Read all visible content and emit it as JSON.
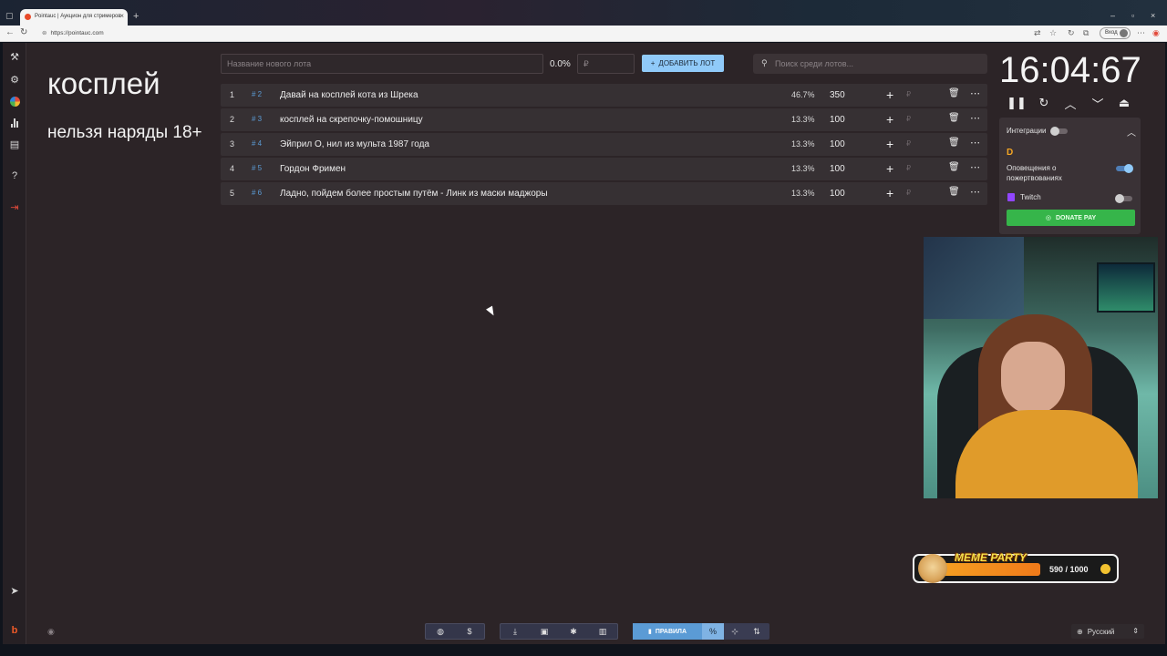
{
  "browser": {
    "tab_title": "Pointauc | Аукцион для стримеров",
    "url": "https://pointauc.com",
    "login_label": "Вход"
  },
  "lot": {
    "title": "косплей",
    "subtitle": "нельзя наряды 18+"
  },
  "controls": {
    "new_lot_placeholder": "Название нового лота",
    "percent": "0.0%",
    "amount_placeholder": "₽",
    "add_button": "ДОБАВИТЬ ЛОТ",
    "search_placeholder": "Поиск среди лотов..."
  },
  "lots": [
    {
      "num": "1",
      "id": "# 2",
      "name": "Давай на косплей кота из Шрека",
      "percent": "46.7%",
      "amount": "350"
    },
    {
      "num": "2",
      "id": "# 3",
      "name": "косплей на скрепочку-помошницу",
      "percent": "13.3%",
      "amount": "100"
    },
    {
      "num": "3",
      "id": "# 4",
      "name": "Эйприл О, нил из мульта 1987 года",
      "percent": "13.3%",
      "amount": "100"
    },
    {
      "num": "4",
      "id": "# 5",
      "name": "Гордон Фримен",
      "percent": "13.3%",
      "amount": "100"
    },
    {
      "num": "5",
      "id": "# 6",
      "name": "Ладно, пойдем более простым путём - Линк из маски маджоры",
      "percent": "13.3%",
      "amount": "100"
    }
  ],
  "lot_currency": "₽",
  "timer": "16:04:67",
  "integrations": {
    "title": "Интеграции",
    "donation_alerts": "Оповещения о пожертвованиях",
    "twitch": "Twitch",
    "donate_pay": "DONATE PAY"
  },
  "bottom": {
    "rules_label": "ПРАВИЛА"
  },
  "overlay": {
    "meme_party": "MEME PARTY",
    "count": "590 / 1000"
  },
  "language": "Русский",
  "colors": {
    "accent": "#90caf9",
    "donate": "#36b54a",
    "background": "#2c2427"
  }
}
